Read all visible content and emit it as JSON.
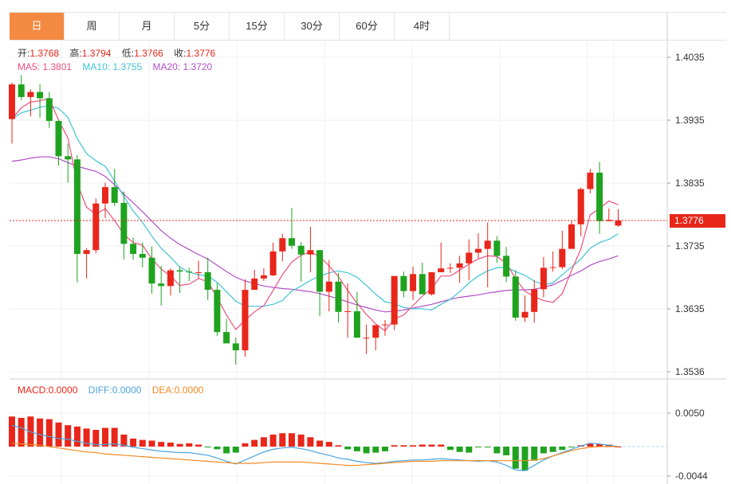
{
  "tabs": [
    "日",
    "周",
    "月",
    "5分",
    "15分",
    "30分",
    "60分",
    "4时"
  ],
  "active_tab": 0,
  "ohlc_legend": {
    "open_label": "开:",
    "open": "1.3768",
    "high_label": "高:",
    "high": "1.3794",
    "low_label": "低:",
    "low": "1.3766",
    "close_label": "收:",
    "close": "1.3776"
  },
  "ma_legend": {
    "ma5_label": "MA5:",
    "ma5": "1.3801",
    "ma10_label": "MA10:",
    "ma10": "1.3755",
    "ma20_label": "MA20:",
    "ma20": "1.3720"
  },
  "macd_legend": {
    "macd_label": "MACD:",
    "macd": "0.0000",
    "diff_label": "DIFF:",
    "diff": "0.0000",
    "dea_label": "DEA:",
    "dea": "0.0000"
  },
  "current_price": "1.3776",
  "colors": {
    "up": "#e8261a",
    "down": "#1fa31f",
    "ma5": "#ee4f7f",
    "ma10": "#3ec4d6",
    "ma20": "#b24fc6",
    "diff": "#4aa3e0",
    "dea": "#f08a24",
    "accent": "#f48a42"
  },
  "chart_data": [
    {
      "type": "candlestick",
      "yticks": [
        "1.4035",
        "1.3935",
        "1.3835",
        "1.3735",
        "1.3635",
        "1.3536"
      ],
      "ylim": [
        1.3536,
        1.4035
      ],
      "grid": true,
      "candles": [
        [
          1.3937,
          1.3995,
          1.3898,
          1.3992
        ],
        [
          1.3992,
          1.4007,
          1.3967,
          1.3972
        ],
        [
          1.3972,
          1.3984,
          1.3941,
          1.398
        ],
        [
          1.398,
          1.3992,
          1.3939,
          1.397
        ],
        [
          1.397,
          1.398,
          1.3923,
          1.3934
        ],
        [
          1.3934,
          1.3935,
          1.3863,
          1.3878
        ],
        [
          1.3878,
          1.3898,
          1.3836,
          1.3873
        ],
        [
          1.3873,
          1.388,
          1.3678,
          1.3723
        ],
        [
          1.3723,
          1.3732,
          1.3684,
          1.3729
        ],
        [
          1.3729,
          1.3811,
          1.3724,
          1.3803
        ],
        [
          1.3803,
          1.3836,
          1.378,
          1.3829
        ],
        [
          1.3829,
          1.3858,
          1.3799,
          1.3804
        ],
        [
          1.3804,
          1.3822,
          1.3714,
          1.3739
        ],
        [
          1.3739,
          1.3749,
          1.3714,
          1.3723
        ],
        [
          1.3723,
          1.3741,
          1.3702,
          1.3717
        ],
        [
          1.3717,
          1.3735,
          1.366,
          1.3676
        ],
        [
          1.3676,
          1.3704,
          1.3641,
          1.3672
        ],
        [
          1.3672,
          1.37,
          1.3657,
          1.3697
        ],
        [
          1.3697,
          1.3703,
          1.3661,
          1.3695
        ],
        [
          1.3695,
          1.3701,
          1.368,
          1.3694
        ],
        [
          1.3694,
          1.3712,
          1.3684,
          1.3694
        ],
        [
          1.3694,
          1.3717,
          1.365,
          1.3666
        ],
        [
          1.3666,
          1.3677,
          1.3593,
          1.3599
        ],
        [
          1.3599,
          1.362,
          1.3588,
          1.3581
        ],
        [
          1.3581,
          1.359,
          1.3547,
          1.357
        ],
        [
          1.357,
          1.3683,
          1.356,
          1.3666
        ],
        [
          1.3666,
          1.3698,
          1.3666,
          1.3684
        ],
        [
          1.3684,
          1.37,
          1.368,
          1.3689
        ],
        [
          1.3689,
          1.3741,
          1.3688,
          1.3727
        ],
        [
          1.3727,
          1.3755,
          1.3711,
          1.3748
        ],
        [
          1.3748,
          1.3796,
          1.3731,
          1.3736
        ],
        [
          1.3736,
          1.3742,
          1.3679,
          1.3722
        ],
        [
          1.3722,
          1.3766,
          1.3694,
          1.3729
        ],
        [
          1.3729,
          1.3728,
          1.3624,
          1.3663
        ],
        [
          1.3663,
          1.3713,
          1.3632,
          1.3679
        ],
        [
          1.3679,
          1.3693,
          1.3614,
          1.3631
        ],
        [
          1.3631,
          1.3676,
          1.359,
          1.3632
        ],
        [
          1.3632,
          1.3663,
          1.3604,
          1.359
        ],
        [
          1.359,
          1.3611,
          1.3564,
          1.359
        ],
        [
          1.359,
          1.3608,
          1.357,
          1.361
        ],
        [
          1.361,
          1.3618,
          1.3593,
          1.3611
        ],
        [
          1.3611,
          1.3682,
          1.3602,
          1.3688
        ],
        [
          1.3688,
          1.3695,
          1.3654,
          1.3664
        ],
        [
          1.3664,
          1.3703,
          1.365,
          1.3691
        ],
        [
          1.3691,
          1.3709,
          1.3661,
          1.3659
        ],
        [
          1.3659,
          1.369,
          1.3657,
          1.3694
        ],
        [
          1.3694,
          1.3741,
          1.3697,
          1.37
        ],
        [
          1.37,
          1.3708,
          1.3693,
          1.3701
        ],
        [
          1.3701,
          1.372,
          1.3677,
          1.3708
        ],
        [
          1.3708,
          1.3746,
          1.3681,
          1.3725
        ],
        [
          1.3725,
          1.3756,
          1.3716,
          1.3731
        ],
        [
          1.3731,
          1.3773,
          1.367,
          1.3744
        ],
        [
          1.3744,
          1.3751,
          1.3709,
          1.372
        ],
        [
          1.372,
          1.3734,
          1.3678,
          1.3687
        ],
        [
          1.3687,
          1.3697,
          1.3617,
          1.3622
        ],
        [
          1.3622,
          1.3657,
          1.3615,
          1.3631
        ],
        [
          1.3631,
          1.3681,
          1.3614,
          1.3667
        ],
        [
          1.3667,
          1.3718,
          1.3654,
          1.3701
        ],
        [
          1.3701,
          1.3727,
          1.3695,
          1.3702
        ],
        [
          1.3702,
          1.376,
          1.3699,
          1.3731
        ],
        [
          1.3731,
          1.3775,
          1.3735,
          1.377
        ],
        [
          1.377,
          1.3828,
          1.3751,
          1.3826
        ],
        [
          1.3826,
          1.3858,
          1.3819,
          1.3852
        ],
        [
          1.3852,
          1.3869,
          1.3755,
          1.3775
        ],
        [
          1.3775,
          1.3795,
          1.3776,
          1.3777
        ],
        [
          1.3768,
          1.3794,
          1.3766,
          1.3776
        ]
      ],
      "ma5": [
        1.3937,
        1.3955,
        1.3964,
        1.3966,
        1.397,
        1.3935,
        1.3907,
        1.3835,
        1.3797,
        1.3786,
        1.3795,
        1.3776,
        1.3754,
        1.3741,
        1.3737,
        1.3715,
        1.3699,
        1.3688,
        1.3673,
        1.3675,
        1.3684,
        1.3679,
        1.3654,
        1.3626,
        1.3603,
        1.3618,
        1.3631,
        1.3641,
        1.3665,
        1.369,
        1.371,
        1.3721,
        1.3726,
        1.3719,
        1.3704,
        1.3687,
        1.3665,
        1.3645,
        1.3627,
        1.3612,
        1.3601,
        1.362,
        1.3626,
        1.3641,
        1.3656,
        1.3668,
        1.3688,
        1.3688,
        1.3697,
        1.3707,
        1.3715,
        1.372,
        1.3719,
        1.3708,
        1.3684,
        1.3664,
        1.3655,
        1.3649,
        1.3646,
        1.366,
        1.3697,
        1.3731,
        1.3785,
        1.3795,
        1.3807,
        1.3801
      ],
      "ma10": [
        1.3937,
        1.3947,
        1.3951,
        1.3956,
        1.3958,
        1.3954,
        1.394,
        1.3906,
        1.3882,
        1.3871,
        1.3862,
        1.3839,
        1.3814,
        1.3791,
        1.3773,
        1.3751,
        1.3732,
        1.3718,
        1.3702,
        1.3694,
        1.369,
        1.3688,
        1.3678,
        1.3663,
        1.3648,
        1.364,
        1.364,
        1.364,
        1.3643,
        1.3649,
        1.3664,
        1.3672,
        1.3681,
        1.3688,
        1.3693,
        1.3696,
        1.3693,
        1.3686,
        1.3673,
        1.3659,
        1.3647,
        1.3644,
        1.3638,
        1.3636,
        1.3636,
        1.3634,
        1.3643,
        1.3651,
        1.3663,
        1.3677,
        1.3688,
        1.3696,
        1.3701,
        1.3702,
        1.3695,
        1.3689,
        1.368,
        1.3674,
        1.3677,
        1.369,
        1.3702,
        1.3715,
        1.3732,
        1.3741,
        1.3746,
        1.3755
      ],
      "ma20": [
        1.387,
        1.3872,
        1.3875,
        1.3877,
        1.3877,
        1.3874,
        1.3868,
        1.3862,
        1.3858,
        1.3854,
        1.3846,
        1.3833,
        1.3818,
        1.3804,
        1.379,
        1.3775,
        1.376,
        1.3748,
        1.3738,
        1.373,
        1.3722,
        1.3715,
        1.3705,
        1.3695,
        1.3686,
        1.368,
        1.3676,
        1.3672,
        1.367,
        1.3668,
        1.3667,
        1.3665,
        1.3663,
        1.366,
        1.3656,
        1.3652,
        1.3647,
        1.3642,
        1.3638,
        1.3634,
        1.3631,
        1.3632,
        1.3634,
        1.3637,
        1.364,
        1.3643,
        1.3647,
        1.3651,
        1.3654,
        1.3656,
        1.3658,
        1.3661,
        1.3663,
        1.3665,
        1.3666,
        1.3666,
        1.3667,
        1.367,
        1.3674,
        1.3681,
        1.3689,
        1.3696,
        1.3705,
        1.3711,
        1.3715,
        1.372
      ]
    },
    {
      "type": "bar",
      "yticks": [
        "0.0050",
        "-0.0044"
      ],
      "ylim": [
        -0.0044,
        0.005
      ],
      "macd": [
        0.0045,
        0.0043,
        0.0045,
        0.0042,
        0.0041,
        0.0036,
        0.0032,
        0.003,
        0.0027,
        0.0025,
        0.0028,
        0.0028,
        0.0018,
        0.0012,
        0.001,
        0.0009,
        0.0007,
        0.0006,
        0.0004,
        0.0005,
        0.0003,
        -0.0001,
        -0.0004,
        -0.001,
        -0.0009,
        0.0005,
        0.001,
        0.0014,
        0.0018,
        0.002,
        0.002,
        0.0018,
        0.0014,
        0.0009,
        0.0007,
        0.0002,
        -0.0004,
        -0.0007,
        -0.001,
        -0.0009,
        -0.0007,
        0.0002,
        0.0002,
        0.0002,
        0.0003,
        0.0003,
        0.0003,
        -0.0005,
        -0.0008,
        -0.0009,
        -0.0001,
        -0.0001,
        -0.001,
        -0.0013,
        -0.0033,
        -0.0036,
        -0.0021,
        -0.001,
        -0.0008,
        -0.0005,
        -0.0001,
        0.0002,
        0.0005,
        0.0004,
        0.0003,
        0.0
      ],
      "diff": [
        0.0032,
        0.0028,
        0.0022,
        0.0018,
        0.0015,
        0.0012,
        0.0011,
        0.0008,
        0.0005,
        0.0003,
        0.0003,
        0.0004,
        0.0002,
        -0.0001,
        -0.0003,
        -0.0005,
        -0.0007,
        -0.0008,
        -0.0009,
        -0.0009,
        -0.0011,
        -0.0013,
        -0.0017,
        -0.0022,
        -0.0026,
        -0.002,
        -0.0014,
        -0.0008,
        -0.0004,
        -0.0002,
        -0.0001,
        -0.0003,
        -0.0006,
        -0.001,
        -0.0013,
        -0.0017,
        -0.0019,
        -0.0022,
        -0.0024,
        -0.0025,
        -0.0024,
        -0.0022,
        -0.0021,
        -0.002,
        -0.002,
        -0.0019,
        -0.0018,
        -0.0019,
        -0.002,
        -0.0021,
        -0.0022,
        -0.0021,
        -0.0023,
        -0.0028,
        -0.0035,
        -0.0036,
        -0.0028,
        -0.002,
        -0.0014,
        -0.0009,
        -0.0004,
        0.0001,
        0.0005,
        0.0004,
        0.0002,
        0.0
      ],
      "dea": [
        0.0005,
        0.0004,
        0.0003,
        0.0002,
        0.0,
        -0.0002,
        -0.0004,
        -0.0006,
        -0.0008,
        -0.0009,
        -0.0011,
        -0.0012,
        -0.0013,
        -0.0014,
        -0.0015,
        -0.0016,
        -0.0017,
        -0.0018,
        -0.0019,
        -0.002,
        -0.0021,
        -0.0022,
        -0.0023,
        -0.0024,
        -0.0025,
        -0.0025,
        -0.0025,
        -0.0024,
        -0.0023,
        -0.0023,
        -0.0023,
        -0.0023,
        -0.0024,
        -0.0025,
        -0.0026,
        -0.0027,
        -0.0028,
        -0.0028,
        -0.0027,
        -0.0026,
        -0.0025,
        -0.0024,
        -0.0023,
        -0.0022,
        -0.0022,
        -0.0022,
        -0.0021,
        -0.0021,
        -0.0021,
        -0.0021,
        -0.0021,
        -0.0021,
        -0.0021,
        -0.0021,
        -0.0021,
        -0.0021,
        -0.002,
        -0.0018,
        -0.0014,
        -0.001,
        -0.0006,
        -0.0003,
        -0.0001,
        0.0,
        0.0,
        0.0
      ]
    }
  ]
}
